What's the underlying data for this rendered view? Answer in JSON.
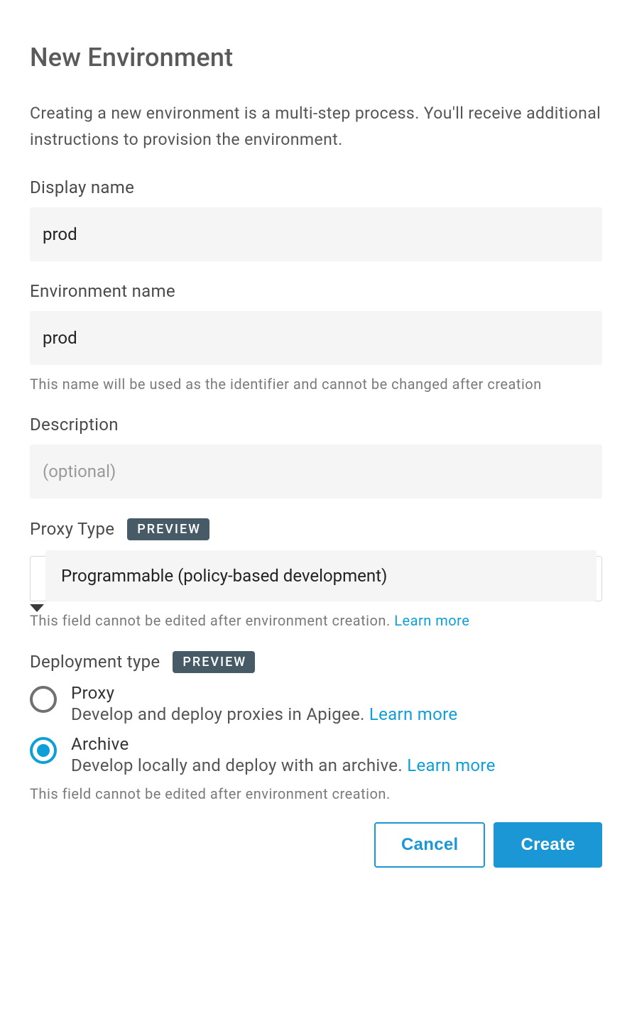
{
  "title": "New Environment",
  "intro": "Creating a new environment is a multi-step process. You'll receive additional instructions to provision the environment.",
  "display_name": {
    "label": "Display name",
    "value": "prod"
  },
  "env_name": {
    "label": "Environment name",
    "value": "prod",
    "helper": "This name will be used as the identifier and cannot be changed after creation"
  },
  "description": {
    "label": "Description",
    "placeholder": "(optional)",
    "value": ""
  },
  "proxy_type": {
    "label": "Proxy Type",
    "badge": "PREVIEW",
    "selected": "Programmable (policy-based development)",
    "helper_prefix": "This field cannot be edited after environment creation. ",
    "learn_more": "Learn more"
  },
  "deployment": {
    "label": "Deployment type",
    "badge": "PREVIEW",
    "options": [
      {
        "title": "Proxy",
        "desc": "Develop and deploy proxies in Apigee. ",
        "learn_more": "Learn more",
        "selected": false
      },
      {
        "title": "Archive",
        "desc": "Develop locally and deploy with an archive. ",
        "learn_more": "Learn more",
        "selected": true
      }
    ],
    "helper": "This field cannot be edited after environment creation."
  },
  "actions": {
    "cancel": "Cancel",
    "create": "Create"
  }
}
